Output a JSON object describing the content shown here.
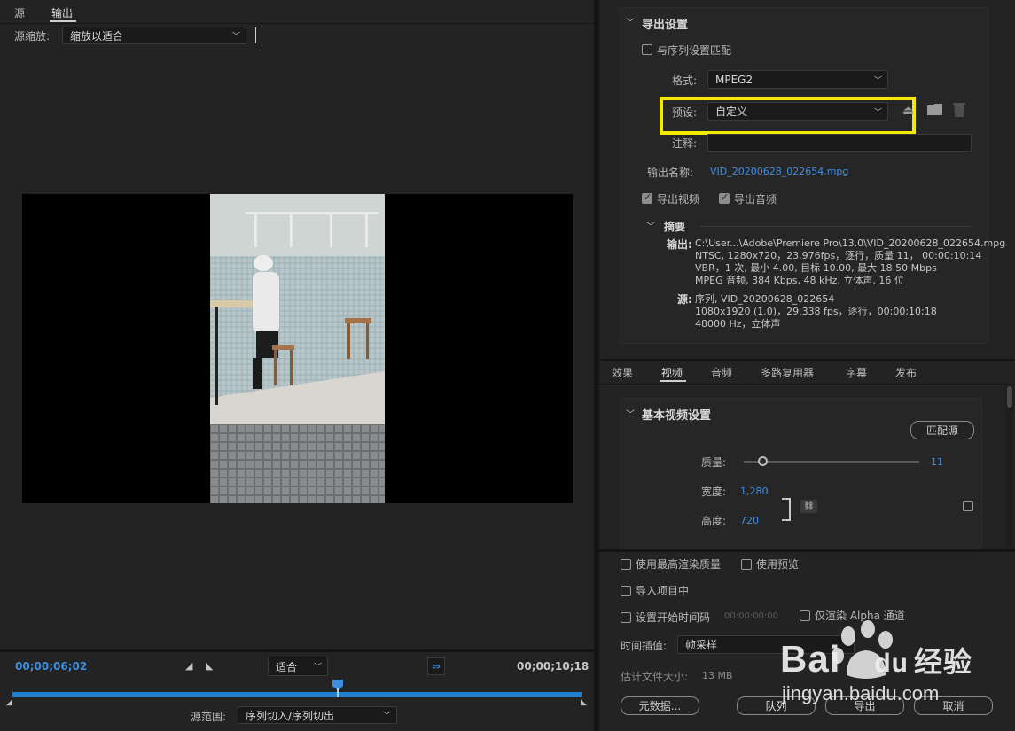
{
  "left": {
    "tabs": [
      "源",
      "输出"
    ],
    "active_tab": "输出",
    "scale_label": "源缩放:",
    "scale_value": "缩放以适合",
    "time_start": "00;00;06;02",
    "fit_value": "适合",
    "time_end": "00;00;10;18",
    "range_label": "源范围:",
    "range_value": "序列切入/序列切出"
  },
  "export": {
    "header": "导出设置",
    "match_seq_label": "与序列设置匹配",
    "format_label": "格式:",
    "format_value": "MPEG2",
    "preset_label": "预设:",
    "preset_value": "自定义",
    "notes_label": "注释:",
    "output_name_label": "输出名称:",
    "output_name_value": "VID_20200628_022654.mpg",
    "export_video_label": "导出视频",
    "export_audio_label": "导出音频",
    "summary_header": "摘要",
    "summary_output_label": "输出:",
    "summary_output_lines": [
      "C:\\User...\\Adobe\\Premiere Pro\\13.0\\VID_20200628_022654.mpg",
      "NTSC, 1280x720，23.976fps，逐行，质量 11，  00:00:10:14",
      "VBR，1 次, 最小 4.00, 目标 10.00, 最大 18.50  Mbps",
      "MPEG 音频, 384 Kbps, 48  kHz, 立体声, 16 位"
    ],
    "summary_source_label": "源:",
    "summary_source_lines": [
      "序列, VID_20200628_022654",
      "1080x1920  (1.0)，29.338  fps，逐行，00;00;10;18",
      "48000 Hz，立体声"
    ]
  },
  "tabs2": [
    "效果",
    "视频",
    "音频",
    "多路复用器",
    "字幕",
    "发布"
  ],
  "active_tab2": "视频",
  "video": {
    "header": "基本视频设置",
    "match_source_button": "匹配源",
    "quality_label": "质量:",
    "quality_value": "11",
    "quality_level": 0.05,
    "width_label": "宽度:",
    "width_value": "1,280",
    "height_label": "高度:",
    "height_value": "720"
  },
  "bottom": {
    "max_render_label": "使用最高渲染质量",
    "use_preview_label": "使用预览",
    "import_project_label": "导入项目中",
    "set_start_tc_label": "设置开始时间码",
    "start_tc_value": "00:00:00:00",
    "alpha_only_label": "仅渲染 Alpha 通道",
    "time_interp_label": "时间插值:",
    "time_interp_value": "帧采样",
    "est_size_label": "估计文件大小:",
    "est_size_value": "13 MB",
    "metadata_button": "元数据...",
    "queue_button": "队列",
    "export_button": "导出",
    "cancel_button": "取消"
  },
  "watermark": {
    "brand": "Bai",
    "brand2": "du",
    "brand3": "经验",
    "url": "jingyan.baidu.com"
  },
  "colors": {
    "accent": "#3f8ee0",
    "highlight_box": "#f2ea00",
    "timeline_bar": "#1f7fd0"
  }
}
